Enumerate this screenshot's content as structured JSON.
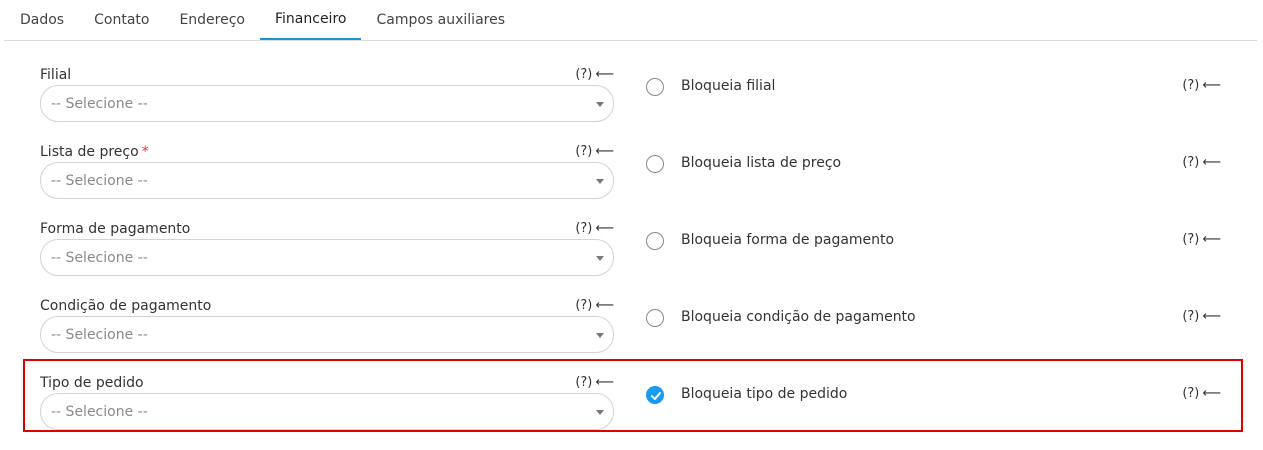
{
  "tabs": [
    {
      "label": "Dados"
    },
    {
      "label": "Contato"
    },
    {
      "label": "Endereço"
    },
    {
      "label": "Financeiro",
      "active": true
    },
    {
      "label": "Campos auxiliares"
    }
  ],
  "fields": [
    {
      "label": "Filial",
      "placeholder": "-- Selecione --",
      "help": "(?)",
      "arrow": "⟵"
    },
    {
      "label": "Lista de preço",
      "required_mark": "*",
      "placeholder": "-- Selecione --",
      "help": "(?)",
      "arrow": "⟵"
    },
    {
      "label": "Forma de pagamento",
      "placeholder": "-- Selecione --",
      "help": "(?)",
      "arrow": "⟵"
    },
    {
      "label": "Condição de pagamento",
      "placeholder": "-- Selecione --",
      "help": "(?)",
      "arrow": "⟵"
    },
    {
      "label": "Tipo de pedido",
      "placeholder": "-- Selecione --",
      "help": "(?)",
      "arrow": "⟵"
    }
  ],
  "toggles": [
    {
      "label": "Bloqueia filial",
      "checked": false,
      "help": "(?)",
      "arrow": "⟵"
    },
    {
      "label": "Bloqueia lista de preço",
      "checked": false,
      "help": "(?)",
      "arrow": "⟵"
    },
    {
      "label": "Bloqueia forma de pagamento",
      "checked": false,
      "help": "(?)",
      "arrow": "⟵"
    },
    {
      "label": "Bloqueia condição de pagamento",
      "checked": false,
      "help": "(?)",
      "arrow": "⟵"
    },
    {
      "label": "Bloqueia tipo de pedido",
      "checked": true,
      "help": "(?)",
      "arrow": "⟵"
    }
  ],
  "colors": {
    "accent": "#1a95d4",
    "checked": "#1a9bf0",
    "required": "#e53935",
    "highlight": "#e00000"
  }
}
